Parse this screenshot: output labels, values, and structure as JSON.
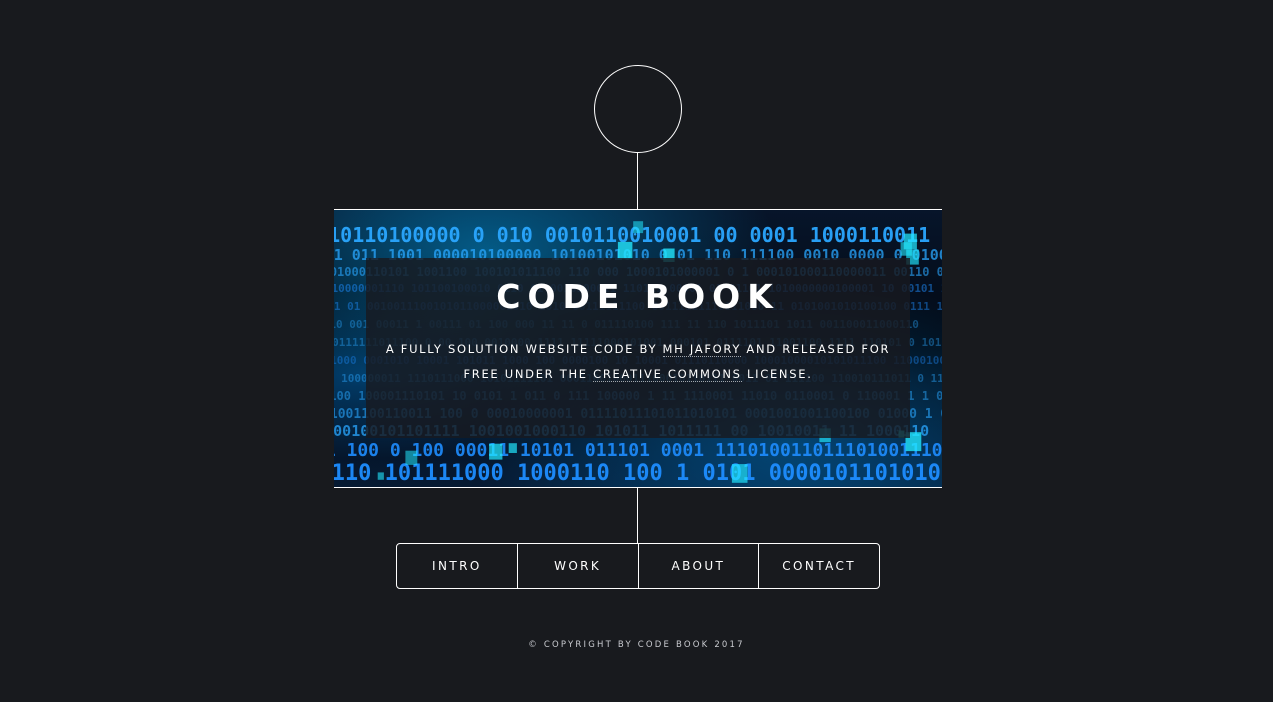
{
  "header": {
    "logo_icon": "circle-logo-icon"
  },
  "hero": {
    "title": "CODE BOOK",
    "desc_part1": "A FULLY SOLUTION WEBSITE CODE BY ",
    "author_link": "MH JAFORY",
    "desc_part2": " AND RELEASED FOR FREE UNDER THE ",
    "license_link": "CREATIVE COMMONS",
    "desc_part3": " LICENSE.",
    "background_icon": "binary-code-background",
    "accent_color": "#00aaff"
  },
  "nav": {
    "items": [
      {
        "label": "INTRO"
      },
      {
        "label": "WORK"
      },
      {
        "label": "ABOUT"
      },
      {
        "label": "CONTACT"
      }
    ]
  },
  "footer": {
    "copyright": "© COPYRIGHT BY CODE BOOK 2017"
  },
  "colors": {
    "background": "#181a1e",
    "text": "#ffffff"
  }
}
